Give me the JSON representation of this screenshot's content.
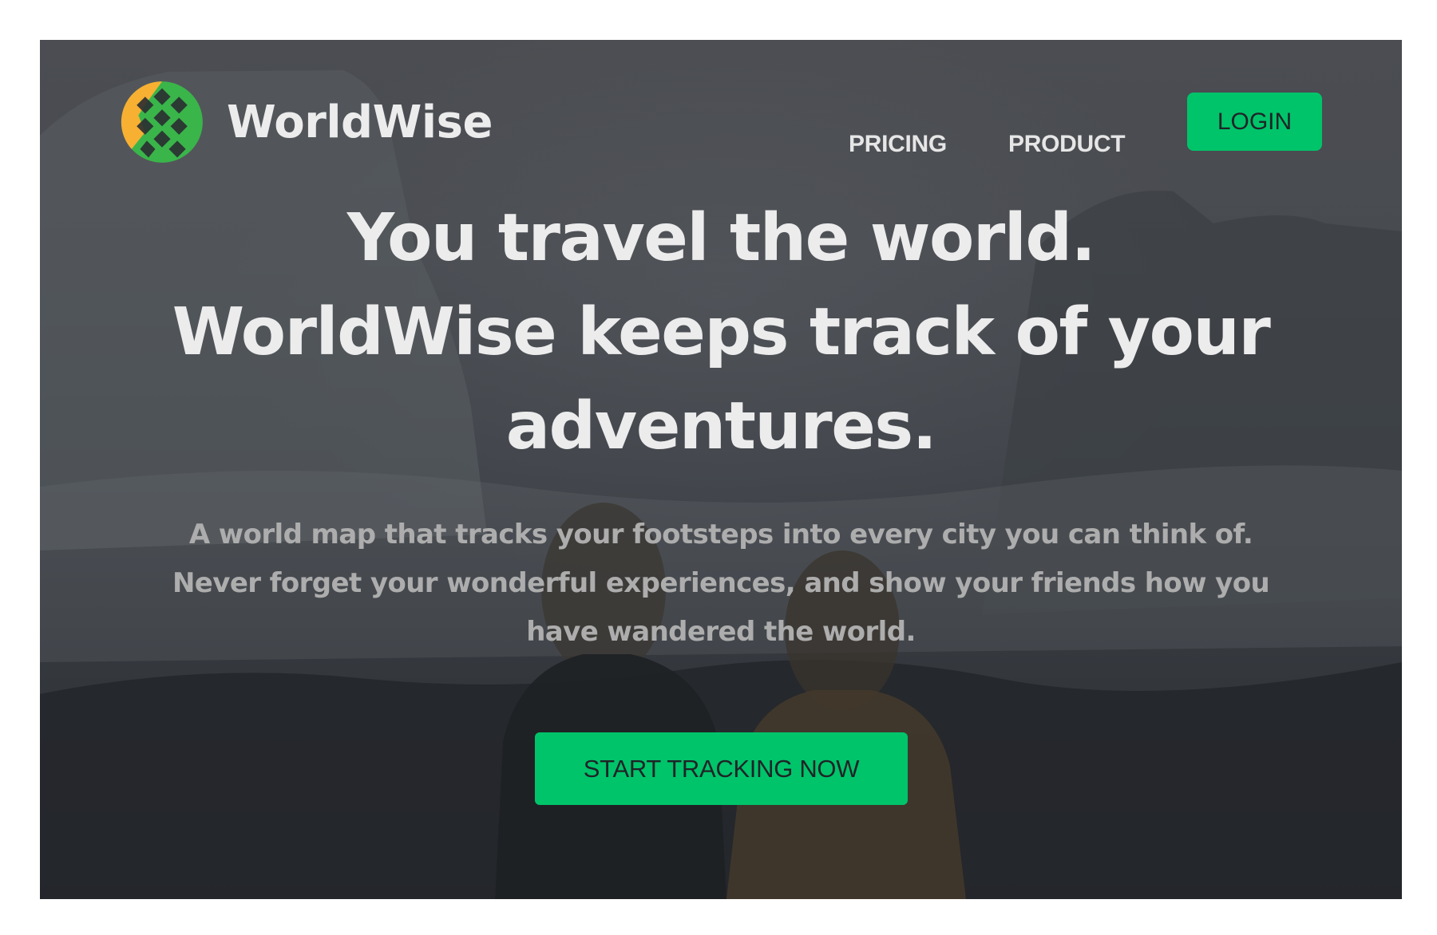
{
  "colors": {
    "accent": "#00c46a",
    "text_light": "#ececec",
    "text_muted": "#adadad",
    "button_text": "#1f2427",
    "logo_green": "#3ab54a",
    "logo_yellow": "#f7b032"
  },
  "brand": {
    "name": "WorldWise",
    "logo_icon": "globe-icon"
  },
  "nav": {
    "links": [
      {
        "label": "PRICING"
      },
      {
        "label": "PRODUCT"
      }
    ],
    "login_label": "LOGIN"
  },
  "hero": {
    "headline_lines": [
      "You travel the world.",
      "WorldWise keeps track of your",
      "adventures."
    ],
    "subtext_lines": [
      "A world map that tracks your footsteps into every city you can think of.",
      "Never forget your wonderful experiences, and show your friends how you",
      "have wandered the world."
    ],
    "cta_label": "START TRACKING NOW",
    "background_image": "mountain-valley-two-women-photo"
  }
}
